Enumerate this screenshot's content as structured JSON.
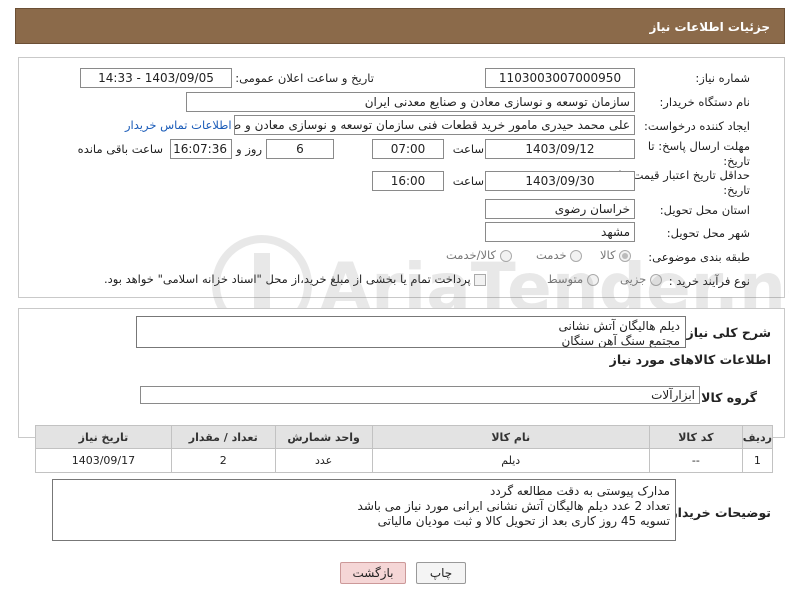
{
  "header": {
    "title": "جزئیات اطلاعات نیاز"
  },
  "form": {
    "need_number_label": "شماره نیاز:",
    "need_number": "1103003007000950",
    "announce_label": "تاریخ و ساعت اعلان عمومی:",
    "announce_value": "1403/09/05 - 14:33",
    "buyer_org_label": "نام دستگاه خریدار:",
    "buyer_org": "سازمان توسعه و نوسازی معادن و صنایع معدنی ایران",
    "creator_label": "ایجاد کننده درخواست:",
    "creator": "علی محمد حیدری مامور خرید قطعات فنی سازمان توسعه و نوسازی معادن و ص",
    "contact_link": "اطلاعات تماس خریدار",
    "deadline_label_1": "مهلت ارسال پاسخ: تا",
    "deadline_label_2": "تاریخ:",
    "deadline_date": "1403/09/12",
    "time_label": "ساعت",
    "deadline_time": "07:00",
    "days_value": "6",
    "days_label": "روز و",
    "remaining_time": "16:07:36",
    "remaining_label": "ساعت باقی مانده",
    "validity_label_1": "حداقل تاریخ اعتبار قیمت: تا",
    "validity_label_2": "تاریخ:",
    "validity_date": "1403/09/30",
    "validity_time": "16:00",
    "province_label": "استان محل تحویل:",
    "province": "خراسان رضوی",
    "city_label": "شهر محل تحویل:",
    "city": "مشهد",
    "category_label": "طبقه بندی موضوعی:",
    "category_options": [
      "کالا",
      "خدمت",
      "کالا/خدمت"
    ],
    "process_label": "نوع فرآیند خرید :",
    "process_options": [
      "جزیی",
      "متوسط"
    ],
    "payment_note": "پرداخت تمام یا بخشی از مبلغ خرید،از محل \"اسناد خزانه اسلامی\" خواهد بود."
  },
  "description": {
    "label": "شرح کلی نیاز:",
    "lines": [
      "دیلم هالیگان آتش نشانی",
      "مجتمع سنگ آهن سنگان"
    ]
  },
  "goods": {
    "section_title": "اطلاعات کالاهای مورد نیاز",
    "group_label": "گروه کالا:",
    "group_value": "ابزارآلات",
    "columns": [
      "ردیف",
      "کد کالا",
      "نام کالا",
      "واحد شمارش",
      "تعداد / مقدار",
      "تاریخ نیاز"
    ],
    "rows": [
      {
        "row": "1",
        "code": "--",
        "name": "دیلم",
        "unit": "عدد",
        "qty": "2",
        "date": "1403/09/17"
      }
    ]
  },
  "buyer_notes": {
    "label": "توضیحات خریدار:",
    "lines": [
      "مدارک پیوستی به دقت مطالعه گردد",
      "تعداد 2 عدد دیلم هالیگان آتش نشانی ایرانی مورد نیاز می باشد",
      "تسویه 45 روز کاری بعد از تحویل کالا و ثبت مودیان مالیاتی"
    ]
  },
  "buttons": {
    "print": "چاپ",
    "back": "بازگشت"
  },
  "watermark": {
    "text": "AriaTender.neT"
  },
  "colors": {
    "header": "#8b6a4a",
    "link": "#1a5bb8",
    "back_button": "#f5d6d6"
  }
}
